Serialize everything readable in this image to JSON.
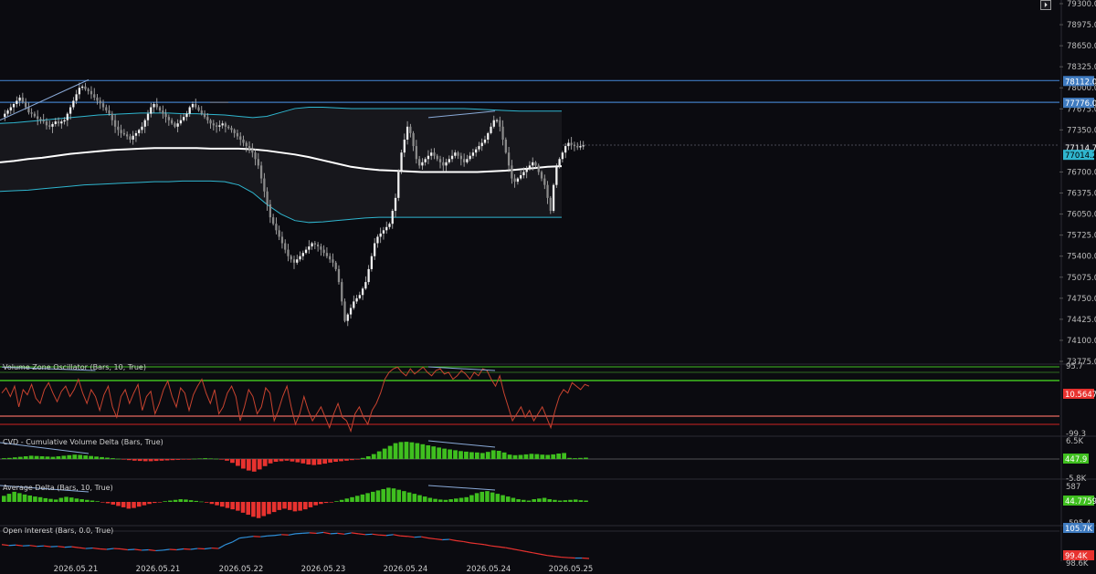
{
  "colors": {
    "background": "#0b0b10",
    "candle_body": "#e6e6e6",
    "bands": "#2fb6cf",
    "vwap": "#ffffff",
    "level_line": "#3f7bc0",
    "vzo_line": "#c8432f",
    "green": "#3fbf1f",
    "red": "#e8322f",
    "blue": "#2f8fd8",
    "divergence": "#8aaad8"
  },
  "icons": {
    "corner_button": "collapse-icon"
  },
  "corner_button_glyph": "⏵",
  "chart_data": [
    {
      "type": "candlestick",
      "pane": "price",
      "ylim": [
        73775,
        79300
      ],
      "y_ticks": [
        "79300.0",
        "78975.0",
        "78650.0",
        "78325.0",
        "78000.0",
        "77675.0",
        "77350.0",
        "76700.0",
        "76375.0",
        "76050.0",
        "75725.0",
        "75400.0",
        "75075.0",
        "74750.0",
        "74425.0",
        "74100.0",
        "73775.0"
      ],
      "x_labels": [
        "2026.05.21",
        "2026.05.21",
        "2026.05.22",
        "2026.05.23",
        "2026.05.24",
        "2026.05.24",
        "2026.05.25"
      ],
      "close_path": [
        77550,
        77600,
        77650,
        77700,
        77750,
        77800,
        77850,
        77780,
        77700,
        77620,
        77600,
        77560,
        77520,
        77500,
        77480,
        77420,
        77400,
        77440,
        77480,
        77450,
        77480,
        77500,
        77600,
        77700,
        77800,
        77900,
        78000,
        78020,
        77980,
        77950,
        77900,
        77850,
        77800,
        77760,
        77700,
        77650,
        77600,
        77500,
        77400,
        77350,
        77300,
        77280,
        77250,
        77200,
        77260,
        77300,
        77350,
        77400,
        77500,
        77600,
        77700,
        77750,
        77700,
        77650,
        77600,
        77550,
        77500,
        77450,
        77400,
        77450,
        77500,
        77550,
        77600,
        77700,
        77750,
        77700,
        77650,
        77600,
        77550,
        77500,
        77450,
        77420,
        77400,
        77420,
        77450,
        77400,
        77380,
        77350,
        77300,
        77250,
        77200,
        77150,
        77100,
        77050,
        77000,
        76900,
        76800,
        76600,
        76400,
        76200,
        76000,
        75900,
        75800,
        75700,
        75600,
        75500,
        75400,
        75350,
        75300,
        75350,
        75400,
        75450,
        75500,
        75550,
        75600,
        75580,
        75550,
        75500,
        75450,
        75400,
        75350,
        75300,
        75200,
        75000,
        74700,
        74400,
        74500,
        74600,
        74700,
        74750,
        74800,
        74900,
        75000,
        75200,
        75400,
        75600,
        75700,
        75750,
        75800,
        75850,
        75900,
        76100,
        76300,
        76700,
        77000,
        77200,
        77400,
        77300,
        77100,
        76900,
        76800,
        76850,
        76900,
        76950,
        77000,
        76950,
        76900,
        76850,
        76800,
        76850,
        76900,
        76950,
        77000,
        76950,
        76900,
        76850,
        76900,
        76950,
        77000,
        77050,
        77100,
        77150,
        77200,
        77300,
        77400,
        77500,
        77500,
        77400,
        77200,
        77000,
        76800,
        76600,
        76550,
        76600,
        76650,
        76700,
        76750,
        76800,
        76850,
        76800,
        76700,
        76600,
        76500,
        76300,
        76100,
        76500,
        76800,
        76900,
        77000,
        77100,
        77150,
        77120,
        77100,
        77080,
        77100,
        77110
      ],
      "vwap": [
        76850,
        76870,
        76900,
        76920,
        76950,
        76980,
        77000,
        77020,
        77040,
        77050,
        77060,
        77070,
        77070,
        77070,
        77070,
        77060,
        77060,
        77060,
        77050,
        77030,
        77000,
        76970,
        76930,
        76880,
        76830,
        76780,
        76750,
        76730,
        76720,
        76710,
        76700,
        76700,
        76700,
        76700,
        76700,
        76710,
        76720,
        76740,
        76760,
        76780,
        76790
      ],
      "upper_band": [
        77450,
        77460,
        77480,
        77500,
        77520,
        77540,
        77560,
        77580,
        77590,
        77600,
        77610,
        77610,
        77610,
        77600,
        77600,
        77590,
        77580,
        77560,
        77540,
        77560,
        77620,
        77680,
        77700,
        77700,
        77690,
        77680,
        77680,
        77680,
        77680,
        77680,
        77680,
        77680,
        77680,
        77680,
        77670,
        77660,
        77650,
        77640,
        77640,
        77640,
        77640
      ],
      "lower_band": [
        76400,
        76410,
        76420,
        76440,
        76460,
        76480,
        76500,
        76510,
        76520,
        76530,
        76540,
        76550,
        76550,
        76560,
        76560,
        76560,
        76550,
        76500,
        76380,
        76200,
        76050,
        75950,
        75920,
        75930,
        75950,
        75970,
        75990,
        76000,
        76000,
        76000,
        76000,
        76000,
        76000,
        76000,
        76000,
        76000,
        76000,
        76000,
        76000,
        76000,
        76000
      ],
      "levels": [
        {
          "price": "78112.0",
          "color": "#3f7bc0"
        },
        {
          "price": "77776.0",
          "color": "#3f7bc0"
        }
      ],
      "last_price": "77114.7",
      "tags": [
        "78112.0",
        "77776.0",
        "77114.7",
        "77014.2"
      ]
    },
    {
      "type": "line",
      "pane": "oscillator",
      "title": "Volume Zone Oscillator (Bars, 10, True)",
      "y_labels": [
        "95.7",
        "-99.3"
      ],
      "value_tag": "10.5647",
      "levels": [
        95.7,
        80,
        -60,
        -80,
        -99.3
      ],
      "values": [
        20,
        35,
        10,
        40,
        -20,
        30,
        15,
        45,
        5,
        -10,
        30,
        50,
        20,
        -5,
        25,
        40,
        10,
        30,
        60,
        20,
        -10,
        30,
        10,
        -30,
        15,
        40,
        -20,
        -50,
        10,
        30,
        -10,
        20,
        45,
        -30,
        10,
        25,
        -40,
        -10,
        30,
        55,
        10,
        -20,
        35,
        20,
        -30,
        15,
        40,
        60,
        20,
        -10,
        30,
        -40,
        -20,
        20,
        40,
        10,
        -60,
        -20,
        30,
        10,
        -40,
        -20,
        35,
        20,
        -60,
        -30,
        10,
        40,
        -20,
        -70,
        -40,
        10,
        -30,
        -60,
        -40,
        -20,
        -50,
        -80,
        -40,
        -10,
        -50,
        -60,
        -90,
        -40,
        -20,
        -50,
        -70,
        -30,
        -10,
        20,
        60,
        80,
        90,
        95,
        80,
        70,
        90,
        75,
        85,
        95,
        80,
        70,
        85,
        90,
        75,
        80,
        60,
        70,
        85,
        75,
        60,
        80,
        70,
        90,
        85,
        60,
        40,
        70,
        20,
        -20,
        -60,
        -40,
        -20,
        -50,
        -30,
        -60,
        -40,
        -20,
        -50,
        -80,
        -30,
        10,
        30,
        20,
        50,
        40,
        30,
        45,
        40
      ],
      "divergence_start": [
        0,
        95
      ],
      "divergence_end": [
        22,
        85
      ]
    },
    {
      "type": "bar",
      "pane": "cvd",
      "title": "CVD - Cumulative Volume Delta (Bars, True)",
      "y_labels": [
        "6.5K",
        "-5.8K"
      ],
      "value_tag": "447.9",
      "values": [
        0.3,
        0.4,
        0.6,
        0.8,
        1,
        1.2,
        1.1,
        1,
        0.9,
        0.8,
        1,
        1.2,
        1.4,
        1.6,
        1.5,
        1.3,
        1.1,
        0.9,
        0.7,
        0.5,
        0.3,
        0.1,
        -0.2,
        -0.4,
        -0.6,
        -0.7,
        -0.8,
        -0.8,
        -0.7,
        -0.6,
        -0.5,
        -0.4,
        -0.3,
        -0.2,
        -0.1,
        0.1,
        0.2,
        0.3,
        0.2,
        0.1,
        -0.2,
        -0.6,
        -1.4,
        -2.5,
        -3.5,
        -4.2,
        -4.6,
        -3.8,
        -2.6,
        -1.6,
        -1,
        -0.8,
        -0.6,
        -0.9,
        -1.2,
        -1.6,
        -2,
        -2.2,
        -2,
        -1.7,
        -1.3,
        -1,
        -0.8,
        -0.6,
        -0.4,
        -0.1,
        0.4,
        1,
        1.8,
        2.8,
        3.8,
        4.8,
        5.8,
        6.2,
        6.3,
        6.1,
        5.8,
        5.4,
        5,
        4.6,
        4.2,
        3.8,
        3.5,
        3.2,
        2.9,
        2.7,
        2.5,
        2.4,
        2.2,
        2.6,
        3.2,
        3,
        2.4,
        1.6,
        1.4,
        1.5,
        1.7,
        1.9,
        1.8,
        1.6,
        1.5,
        1.7,
        2,
        2.2,
        0.4,
        0.3,
        0.4,
        0.5
      ]
    },
    {
      "type": "bar",
      "pane": "average_delta",
      "title": "Average Delta (Bars, 10, True)",
      "y_labels": [
        "587",
        "-595.4"
      ],
      "value_tag": "44.7759",
      "values": [
        180,
        240,
        300,
        260,
        220,
        190,
        160,
        140,
        110,
        90,
        70,
        120,
        150,
        130,
        100,
        80,
        60,
        40,
        20,
        -10,
        -40,
        -80,
        -120,
        -160,
        -200,
        -180,
        -140,
        -100,
        -60,
        -30,
        -10,
        20,
        40,
        60,
        80,
        70,
        50,
        30,
        10,
        -20,
        -60,
        -100,
        -140,
        -180,
        -220,
        -260,
        -320,
        -380,
        -440,
        -480,
        -420,
        -360,
        -300,
        -240,
        -200,
        -240,
        -280,
        -260,
        -220,
        -160,
        -100,
        -60,
        -30,
        -10,
        20,
        60,
        100,
        140,
        180,
        220,
        260,
        300,
        340,
        380,
        420,
        400,
        360,
        320,
        280,
        240,
        200,
        160,
        120,
        90,
        70,
        60,
        80,
        100,
        120,
        140,
        200,
        260,
        300,
        320,
        280,
        240,
        200,
        160,
        120,
        80,
        60,
        40,
        80,
        100,
        120,
        80,
        60,
        40,
        50,
        60,
        70,
        50,
        40
      ]
    },
    {
      "type": "line",
      "pane": "open_interest",
      "title": "Open Interest (Bars, 0.0, True)",
      "y_labels": [
        "105.7K",
        "99.4K",
        "98.6K"
      ],
      "value_tag_top": "105.7K",
      "value_tag_bottom": "99.4K",
      "values": [
        102.6,
        102.4,
        102.5,
        102.3,
        102.4,
        102.2,
        102.3,
        102.1,
        102.2,
        102.0,
        102.1,
        101.9,
        101.7,
        101.8,
        101.6,
        101.5,
        101.7,
        101.6,
        101.4,
        101.5,
        101.3,
        101.4,
        101.2,
        101.3,
        101.5,
        101.4,
        101.6,
        101.5,
        101.7,
        101.6,
        101.8,
        101.7,
        102.6,
        103.2,
        104.1,
        104.3,
        104.5,
        104.4,
        104.6,
        104.7,
        104.9,
        104.8,
        105.1,
        105.2,
        105.3,
        105.2,
        105.4,
        105.1,
        105.2,
        105.0,
        105.3,
        105.1,
        104.9,
        105.0,
        104.8,
        104.7,
        104.9,
        104.6,
        104.5,
        104.3,
        104.4,
        104.1,
        103.9,
        103.7,
        103.8,
        103.5,
        103.3,
        103.0,
        102.8,
        102.6,
        102.3,
        102.1,
        101.9,
        101.6,
        101.3,
        101.0,
        100.7,
        100.4,
        100.1,
        99.9,
        99.7,
        99.6,
        99.5,
        99.5,
        99.4
      ]
    }
  ]
}
